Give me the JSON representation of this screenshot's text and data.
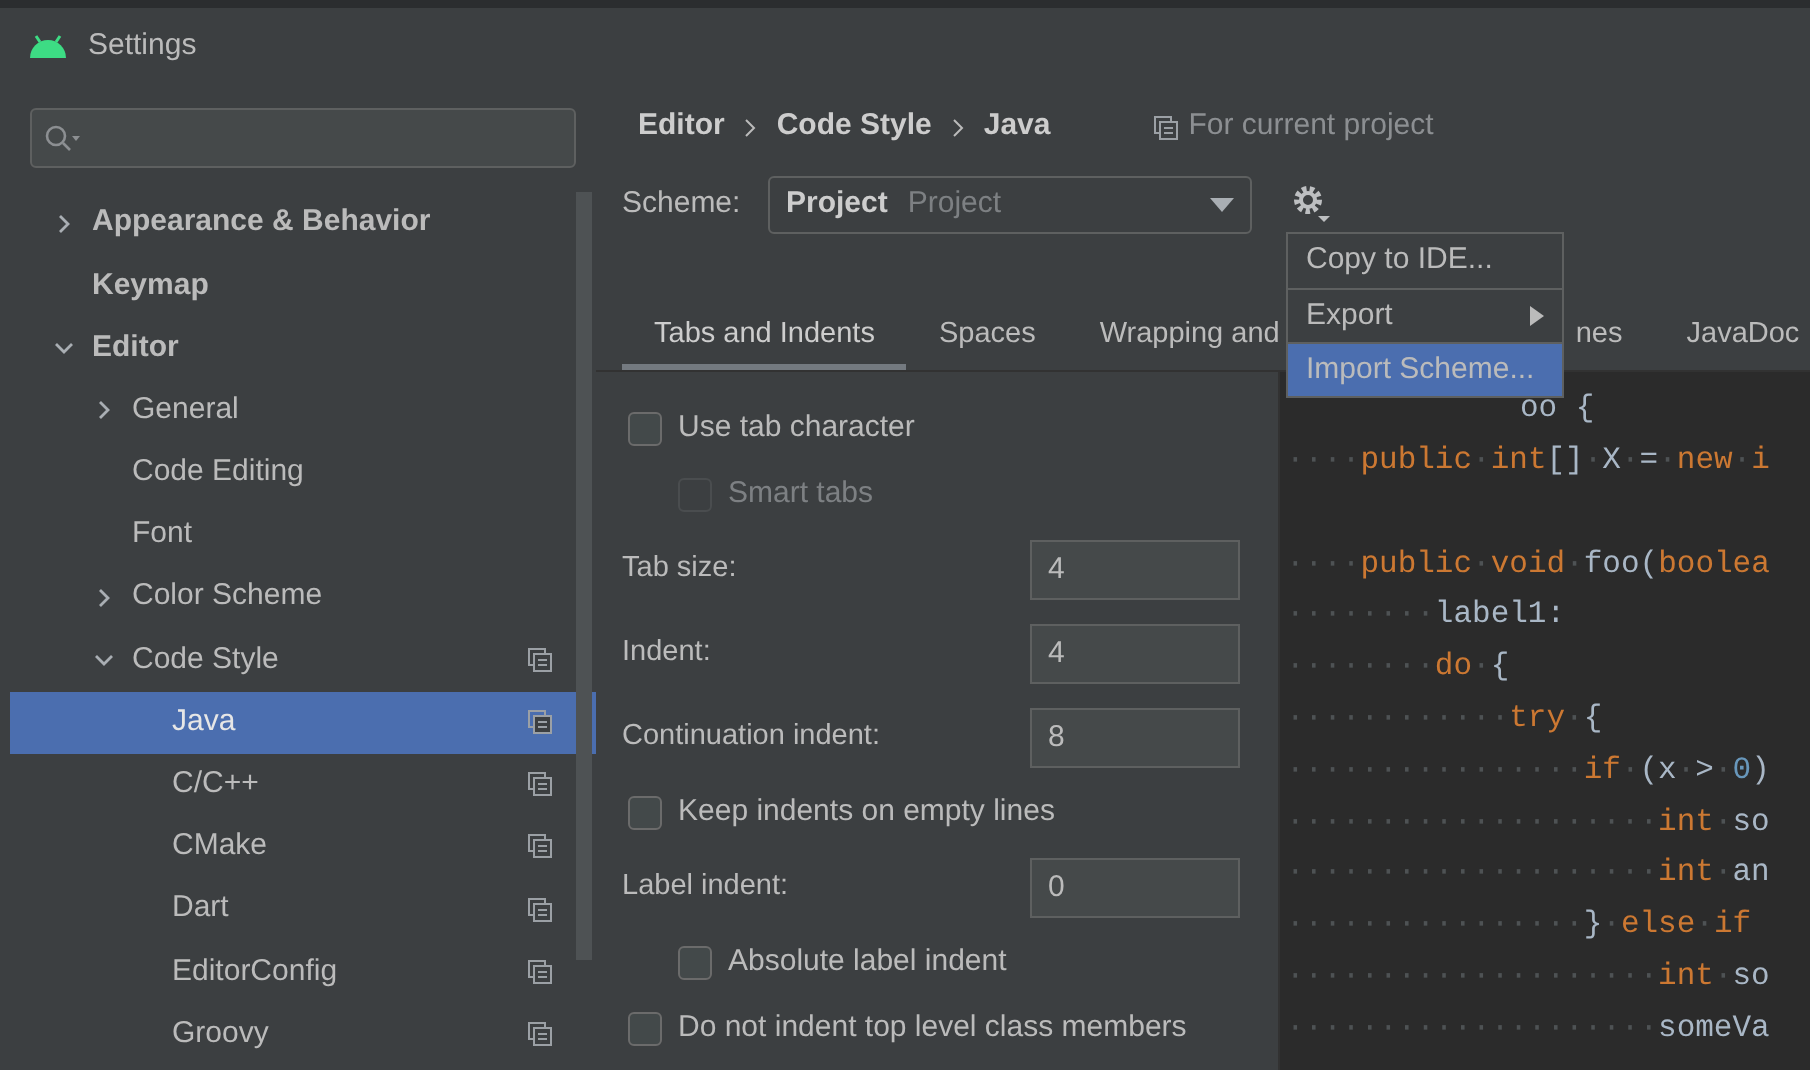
{
  "window": {
    "title": "Settings"
  },
  "tree": [
    {
      "label": "Appearance & Behavior",
      "bold": true,
      "expanded": false,
      "expandable": true,
      "scoped": false,
      "selected": false
    },
    {
      "label": "Keymap",
      "bold": true,
      "expandable": false,
      "scoped": false,
      "selected": false
    },
    {
      "label": "Editor",
      "bold": true,
      "expanded": true,
      "expandable": true,
      "scoped": false,
      "selected": false,
      "children": [
        {
          "label": "General",
          "bold": false,
          "expandable": true,
          "expanded": false,
          "scoped": false,
          "selected": false
        },
        {
          "label": "Code Editing",
          "bold": false,
          "expandable": false,
          "scoped": false,
          "selected": false
        },
        {
          "label": "Font",
          "bold": false,
          "expandable": false,
          "scoped": false,
          "selected": false
        },
        {
          "label": "Color Scheme",
          "bold": false,
          "expandable": true,
          "expanded": false,
          "scoped": false,
          "selected": false
        },
        {
          "label": "Code Style",
          "bold": false,
          "expandable": true,
          "expanded": true,
          "scoped": true,
          "selected": false,
          "children": [
            {
              "label": "Java",
              "bold": false,
              "expandable": false,
              "scoped": true,
              "selected": true
            },
            {
              "label": "C/C++",
              "bold": false,
              "expandable": false,
              "scoped": true,
              "selected": false
            },
            {
              "label": "CMake",
              "bold": false,
              "expandable": false,
              "scoped": true,
              "selected": false
            },
            {
              "label": "Dart",
              "bold": false,
              "expandable": false,
              "scoped": true,
              "selected": false
            },
            {
              "label": "EditorConfig",
              "bold": false,
              "expandable": false,
              "scoped": true,
              "selected": false
            },
            {
              "label": "Groovy",
              "bold": false,
              "expandable": false,
              "scoped": true,
              "selected": false
            }
          ]
        }
      ]
    }
  ],
  "breadcrumb": [
    "Editor",
    "Code Style",
    "Java"
  ],
  "scope_note": "For current project",
  "scheme": {
    "label": "Scheme:",
    "name": "Project",
    "detail": "Project"
  },
  "menu": [
    {
      "label": "Copy to IDE...",
      "submenu": false,
      "selected": false
    },
    {
      "label": "Export",
      "submenu": true,
      "selected": false
    },
    {
      "label": "Import Scheme...",
      "submenu": false,
      "selected": true
    }
  ],
  "tabs": [
    {
      "label": "Tabs and Indents",
      "selected": true,
      "kind": "full"
    },
    {
      "label": "Spaces",
      "selected": false,
      "kind": "full"
    },
    {
      "label": "Wrapping and",
      "selected": false,
      "kind": "cut-end"
    },
    {
      "label": "nes",
      "selected": false,
      "kind": "cut-start"
    },
    {
      "label": "JavaDoc",
      "selected": false,
      "kind": "full"
    }
  ],
  "options": [
    {
      "kind": "checkbox",
      "label": "Use tab character",
      "checked": false,
      "disabled": false,
      "children": [
        {
          "kind": "checkbox",
          "label": "Smart tabs",
          "checked": false,
          "disabled": true
        }
      ]
    },
    {
      "kind": "number",
      "label": "Tab size:",
      "value": "4"
    },
    {
      "kind": "number",
      "label": "Indent:",
      "value": "4"
    },
    {
      "kind": "number",
      "label": "Continuation indent:",
      "value": "8"
    },
    {
      "kind": "checkbox",
      "label": "Keep indents on empty lines",
      "checked": false,
      "disabled": false
    },
    {
      "kind": "number",
      "label": "Label indent:",
      "value": "0",
      "children": [
        {
          "kind": "checkbox",
          "label": "Absolute label indent",
          "checked": false,
          "disabled": false
        }
      ]
    },
    {
      "kind": "checkbox",
      "label": "Do not indent top level class members",
      "checked": false,
      "disabled": false
    }
  ],
  "code": [
    {
      "kind": "partial",
      "tokens": [
        {
          "kind": "plain",
          "text": "oo {"
        }
      ]
    },
    {
      "kind": "full",
      "tokens": [
        {
          "kind": "indent",
          "text": "····"
        },
        {
          "kind": "keyword",
          "text": "public"
        },
        {
          "kind": "indent",
          "text": "·"
        },
        {
          "kind": "keyword",
          "text": "int"
        },
        {
          "kind": "plain",
          "text": "[]"
        },
        {
          "kind": "indent",
          "text": "·"
        },
        {
          "kind": "plain",
          "text": "X"
        },
        {
          "kind": "indent",
          "text": "·"
        },
        {
          "kind": "plain",
          "text": "="
        },
        {
          "kind": "indent",
          "text": "·"
        },
        {
          "kind": "keyword",
          "text": "new"
        },
        {
          "kind": "indent",
          "text": "·"
        },
        {
          "kind": "keyword",
          "text": "i"
        }
      ]
    },
    {
      "kind": "blank"
    },
    {
      "kind": "full",
      "tokens": [
        {
          "kind": "indent",
          "text": "····"
        },
        {
          "kind": "keyword",
          "text": "public"
        },
        {
          "kind": "indent",
          "text": "·"
        },
        {
          "kind": "keyword",
          "text": "void"
        },
        {
          "kind": "indent",
          "text": "·"
        },
        {
          "kind": "plain",
          "text": "foo("
        },
        {
          "kind": "keyword",
          "text": "boolea"
        }
      ]
    },
    {
      "kind": "full",
      "tokens": [
        {
          "kind": "indent",
          "text": "········"
        },
        {
          "kind": "plain",
          "text": "label1:"
        }
      ]
    },
    {
      "kind": "full",
      "tokens": [
        {
          "kind": "indent",
          "text": "········"
        },
        {
          "kind": "keyword",
          "text": "do"
        },
        {
          "kind": "indent",
          "text": "·"
        },
        {
          "kind": "plain",
          "text": "{"
        }
      ]
    },
    {
      "kind": "full",
      "tokens": [
        {
          "kind": "indent",
          "text": "············"
        },
        {
          "kind": "keyword",
          "text": "try"
        },
        {
          "kind": "indent",
          "text": "·"
        },
        {
          "kind": "plain",
          "text": "{"
        }
      ]
    },
    {
      "kind": "full",
      "tokens": [
        {
          "kind": "indent",
          "text": "················"
        },
        {
          "kind": "keyword",
          "text": "if"
        },
        {
          "kind": "indent",
          "text": "·"
        },
        {
          "kind": "plain",
          "text": "(x"
        },
        {
          "kind": "indent",
          "text": "·"
        },
        {
          "kind": "plain",
          "text": ">"
        },
        {
          "kind": "indent",
          "text": "·"
        },
        {
          "kind": "number",
          "text": "0"
        },
        {
          "kind": "plain",
          "text": ")"
        }
      ]
    },
    {
      "kind": "full",
      "tokens": [
        {
          "kind": "indent",
          "text": "····················"
        },
        {
          "kind": "keyword",
          "text": "int"
        },
        {
          "kind": "indent",
          "text": "·"
        },
        {
          "kind": "plain",
          "text": "so"
        }
      ]
    },
    {
      "kind": "full",
      "tokens": [
        {
          "kind": "indent",
          "text": "····················"
        },
        {
          "kind": "keyword",
          "text": "int"
        },
        {
          "kind": "indent",
          "text": "·"
        },
        {
          "kind": "plain",
          "text": "an"
        }
      ]
    },
    {
      "kind": "full",
      "tokens": [
        {
          "kind": "indent",
          "text": "················"
        },
        {
          "kind": "plain",
          "text": "}"
        },
        {
          "kind": "indent",
          "text": "·"
        },
        {
          "kind": "keyword",
          "text": "else"
        },
        {
          "kind": "indent",
          "text": "·"
        },
        {
          "kind": "keyword",
          "text": "if"
        }
      ]
    },
    {
      "kind": "full",
      "tokens": [
        {
          "kind": "indent",
          "text": "····················"
        },
        {
          "kind": "keyword",
          "text": "int"
        },
        {
          "kind": "indent",
          "text": "·"
        },
        {
          "kind": "plain",
          "text": "so"
        }
      ]
    },
    {
      "kind": "full",
      "tokens": [
        {
          "kind": "indent",
          "text": "····················"
        },
        {
          "kind": "plain",
          "text": "someVa"
        }
      ]
    }
  ]
}
